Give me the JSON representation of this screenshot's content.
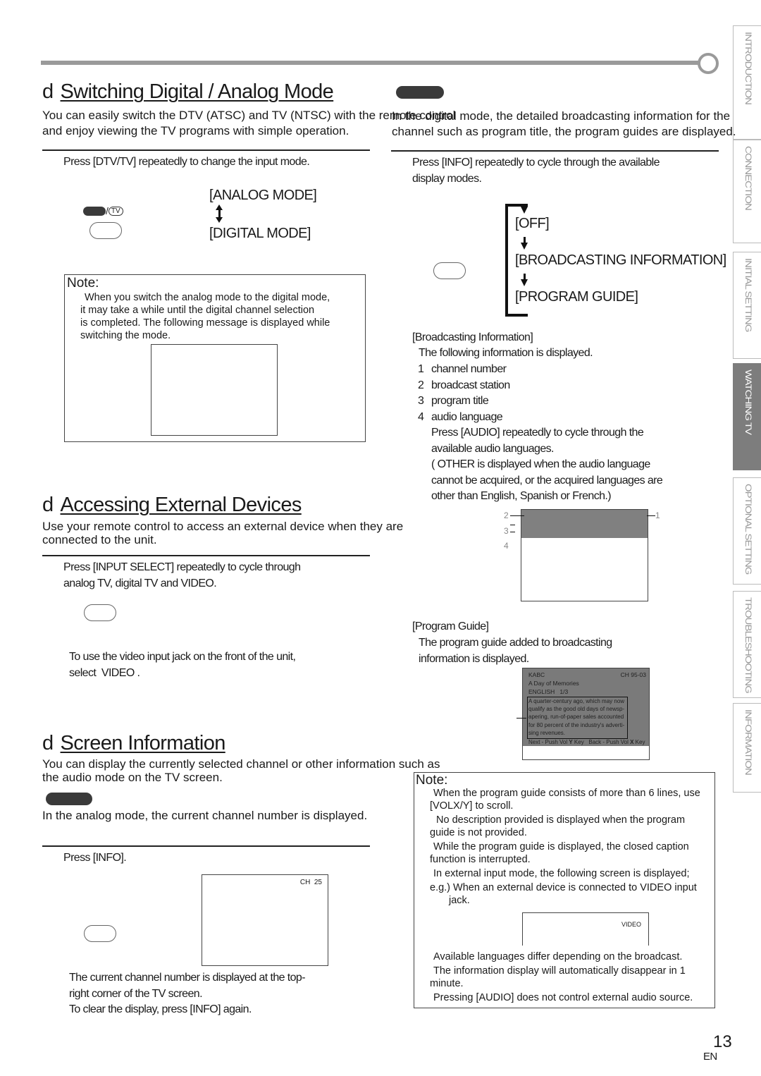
{
  "side_tabs": [
    {
      "label": "INTRODUCTION",
      "active": false
    },
    {
      "label": "CONNECTION",
      "active": false
    },
    {
      "label": "INITIAL SETTING",
      "active": false
    },
    {
      "label": "WATCHING TV",
      "active": true
    },
    {
      "label": "OPTIONAL SETTING",
      "active": false
    },
    {
      "label": "TROUBLESHOOTING",
      "active": false
    },
    {
      "label": "INFORMATION",
      "active": false
    }
  ],
  "switching": {
    "bullet": "d",
    "title": "Switching Digital / Analog Mode",
    "intro": "You can easily switch the DTV (ATSC) and TV (NTSC) with the remote control and enjoy viewing the TV programs with simple operation.",
    "intro_line1": "You can easily switch the DTV (ATSC) and TV (NTSC) with the remote control",
    "intro_line2": "and enjoy viewing the TV programs with simple operation.",
    "step": "Press [DTV/TV] repeatedly to change the input mode.",
    "button_label": "/TV",
    "tv_glyph": "TV",
    "mode_a": "[ANALOG MODE]",
    "mode_b": "[DIGITAL MODE]",
    "note_title": "Note:",
    "note_lines": [
      "When you switch the analog mode to the digital mode,",
      "it may take a while until the digital channel selection",
      "is completed. The following message is displayed while",
      "switching the mode."
    ]
  },
  "digital_info": {
    "intro_line1": "In the digital mode, the detailed broadcasting information for the",
    "intro_line2": "channel such as program title, the program guides are displayed.",
    "step_line1": "Press [INFO] repeatedly to cycle through the available",
    "step_line2": "display modes.",
    "cycle": [
      "[OFF]",
      "[BROADCASTING INFORMATION]",
      "[PROGRAM GUIDE]"
    ],
    "broadcasting": {
      "heading": "[Broadcasting Information]",
      "desc": "The following information is displayed.",
      "items": [
        {
          "num": "1",
          "text": "channel number"
        },
        {
          "num": "2",
          "text": "broadcast station"
        },
        {
          "num": "3",
          "text": "program title"
        },
        {
          "num": "4",
          "text": "audio language"
        }
      ],
      "audio_lines": [
        "Press [AUDIO] repeatedly to cycle through the",
        "available audio languages.",
        "( OTHER is displayed when the audio language",
        "cannot be acquired, or the acquired languages are",
        "other than English, Spanish or French.)"
      ],
      "callouts": [
        "1",
        "2",
        "3",
        "4"
      ]
    },
    "program_guide": {
      "heading": "[Program Guide]",
      "desc_line1": "The program guide added to broadcasting",
      "desc_line2": "information is displayed.",
      "screen": {
        "station": "KABC",
        "channel": "CH 95-03",
        "title": "A Day of Memories",
        "audio": "ENGLISH   1/3",
        "description": [
          "A quarter-century ago, which may now",
          "qualify as the good old days of newsp-",
          "apering, run-of-paper sales accounted",
          "for 80 percent of the industry's adverti-",
          "sing revenues."
        ],
        "next_hint": "Next - Push Vol ",
        "next_key": "Y",
        "next_suffix": " Key",
        "back_hint": "Back - Push Vol ",
        "back_key": "X",
        "back_suffix": " Key"
      }
    }
  },
  "external": {
    "bullet": "d",
    "title": "Accessing External Devices",
    "intro_line1": "Use your remote control to access an external device when they are",
    "intro_line2": "connected to the unit.",
    "step_line1": "Press [INPUT SELECT] repeatedly to cycle through",
    "step_line2": "analog TV, digital TV and VIDEO.",
    "tip_line1": "To use the video input jack on the front of the unit,",
    "tip_line2": "select  VIDEO ."
  },
  "screen_info": {
    "bullet": "d",
    "title": "Screen Information",
    "intro_line1": "You can display the currently selected channel or other information such as",
    "intro_line2": "the audio mode on the TV screen.",
    "analog_desc": "In the analog mode, the current channel number is displayed.",
    "step": "Press [INFO].",
    "channel_display": "CH  25",
    "result_lines": [
      "The current channel number is displayed at the top-",
      "right corner of the TV screen.",
      "To clear the display, press [INFO] again."
    ]
  },
  "note2": {
    "title": "Note:",
    "items": [
      {
        "l1": "When the program guide consists of more than 6 lines, use",
        "l2": "[VOLX/Y] to scroll."
      },
      {
        "l1": "No description provided  is displayed when the program",
        "l2": "guide is not provided."
      },
      {
        "l1": "While the program guide is displayed, the closed caption",
        "l2": "function is interrupted."
      },
      {
        "l1": "In external input mode, the following screen is displayed;",
        "l2": "e.g.) When an external device is connected to VIDEO input",
        "l3": "jack."
      }
    ],
    "video_label": "VIDEO",
    "tail": [
      "Available languages differ depending on the broadcast.",
      "The information display will automatically disappear in 1",
      "minute.",
      "Pressing [AUDIO] does not control external audio source."
    ]
  },
  "footer": {
    "page_number": "13",
    "lang": "EN"
  }
}
